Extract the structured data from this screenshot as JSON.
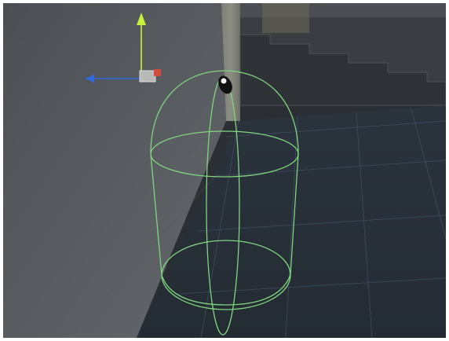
{
  "scene": {
    "tiny_label": "",
    "colors": {
      "wall": "#5b5e62",
      "floor": "#28313b",
      "grid": "#3f5263",
      "pillar": "#8c8d83",
      "capsule": "#7fd67f",
      "gizmo_y": "#c6f03a",
      "gizmo_x": "#d54b3b",
      "gizmo_z": "#2f6ad9"
    },
    "icons": {
      "gizmo": "transform-gizmo-icon",
      "camera": "camera-icon"
    }
  }
}
